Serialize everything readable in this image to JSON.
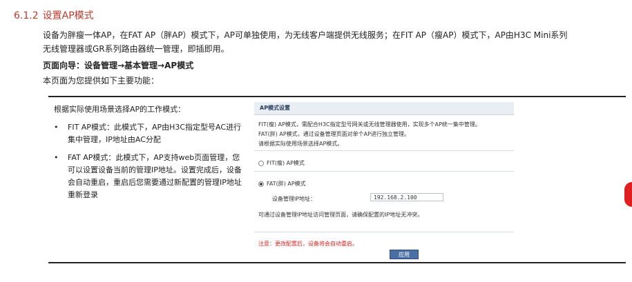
{
  "section": {
    "number": "6.1.2",
    "title": "设置AP模式"
  },
  "paragraphs": {
    "p1": "设备为胖瘦一体AP，在FAT AP（胖AP）模式下，AP可单独使用，为无线客户端提供无线服务；在FIT AP（瘦AP）模式下，AP由H3C Mini系列",
    "p2": "无线管理器或GR系列路由器统一管理，即插即用。",
    "p3": "页面向导：设备管理→基本管理→AP模式",
    "p4": "本页面为您提供如下主要功能："
  },
  "left": {
    "intro": "根据实际使用场景选择AP的工作模式：",
    "bullets": [
      "FIT AP模式：此模式下，AP由H3C指定型号AC进行集中管理，IP地址由AC分配",
      "FAT AP模式：此模式下，AP支持web页面管理，您可以设置设备当前的管理IP地址。设置完成后，设备会自动重启，重启后您需要通过新配置的管理IP地址重新登录"
    ],
    "bullet_symbol": "•"
  },
  "panel": {
    "header": "AP模式设置",
    "desc1": "FIT(瘦) AP模式，需配合H3C指定型号网关或无线管理器使用，实现多个AP统一集中管理。",
    "desc2": "FAT(胖) AP模式，通过设备管理页面对单个AP进行独立管理。",
    "desc3": "请根据实际使用场景选择AP模式。",
    "fit_label": "FIT(瘦) AP模式",
    "fat_label": "FAT(胖) AP模式",
    "ip_label": "设备管理IP地址：",
    "ip_value": "192.168.2.100",
    "ip_note": "可通过设备管理IP地址访问管理页面，请确保配置的IP地址无冲突。",
    "note": "注意：更改配置后，设备将会自动重启。",
    "apply": "应用"
  },
  "colors": {
    "title": "#c0392b",
    "note": "#e02020",
    "button": "#4a6fa5",
    "header_bg": "#e9eef5"
  }
}
